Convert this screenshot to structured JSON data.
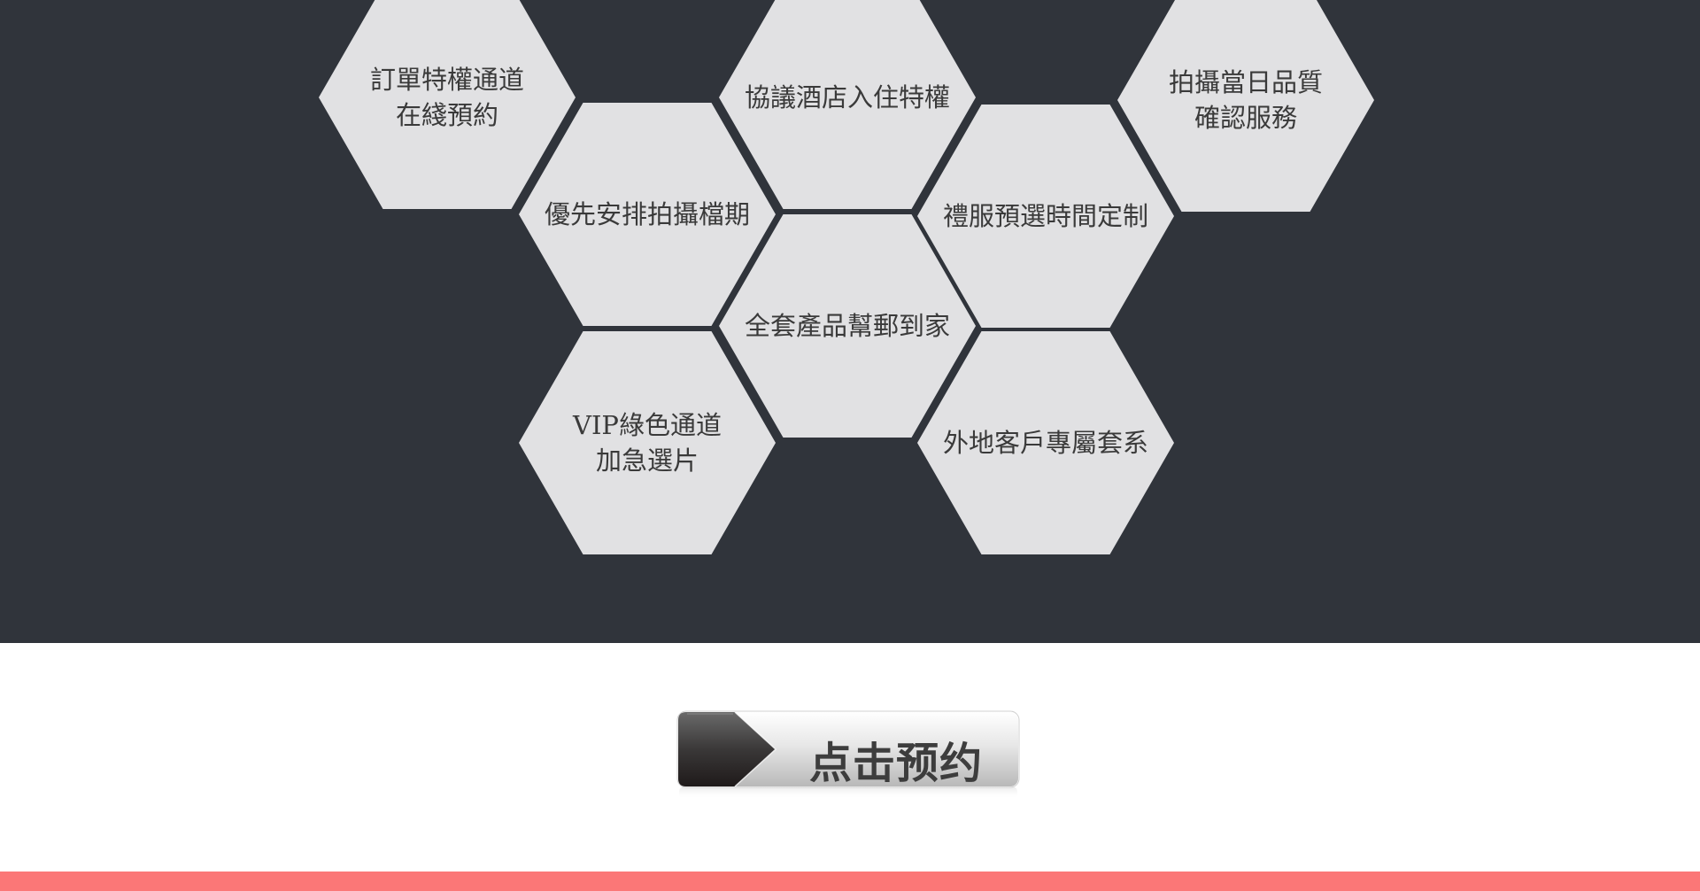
{
  "features": [
    {
      "id": "f1",
      "lines": [
        "訂單特權通道",
        "在綫預約"
      ]
    },
    {
      "id": "f2",
      "lines": [
        "協議酒店入住特權"
      ]
    },
    {
      "id": "f3",
      "lines": [
        "拍攝當日品質",
        "確認服務"
      ]
    },
    {
      "id": "f4",
      "lines": [
        "優先安排拍攝檔期"
      ]
    },
    {
      "id": "f5",
      "lines": [
        "禮服預選時間定制"
      ]
    },
    {
      "id": "f6",
      "lines": [
        "全套產品幫郵到家"
      ]
    },
    {
      "id": "f7",
      "lines": [
        "VIP綠色通道",
        "加急選片"
      ]
    },
    {
      "id": "f8",
      "lines": [
        "外地客戶專屬套系"
      ]
    }
  ],
  "cta": {
    "label": "点击预约"
  },
  "colors": {
    "dark_bg": "#30343b",
    "hex_fill": "#e1e1e3",
    "hex_text": "#3a3a3a",
    "bottom_bar": "#fb7777"
  }
}
